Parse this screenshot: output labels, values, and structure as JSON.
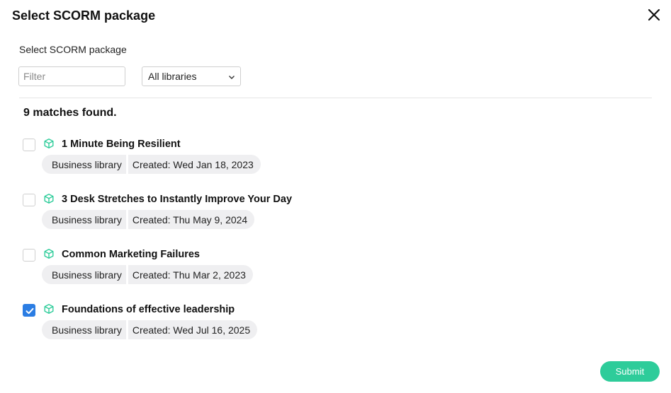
{
  "dialog": {
    "title": "Select SCORM package",
    "close_icon": "close-icon"
  },
  "form": {
    "subtitle": "Select SCORM package",
    "filter_placeholder": "Filter",
    "filter_value": "",
    "library_select": "All libraries"
  },
  "results": {
    "summary": "9 matches found.",
    "items": [
      {
        "title": "1 Minute Being Resilient",
        "library": "Business library",
        "created": "Created: Wed Jan 18, 2023",
        "checked": false
      },
      {
        "title": "3 Desk Stretches to Instantly Improve Your Day",
        "library": "Business library",
        "created": "Created: Thu May 9, 2024",
        "checked": false
      },
      {
        "title": "Common Marketing Failures",
        "library": "Business library",
        "created": "Created: Thu Mar 2, 2023",
        "checked": false
      },
      {
        "title": "Foundations of effective leadership",
        "library": "Business library",
        "created": "Created: Wed Jul 16, 2025",
        "checked": true
      }
    ]
  },
  "footer": {
    "submit_label": "Submit"
  },
  "colors": {
    "accent": "#2ecc9a",
    "checkbox_checked": "#2b7de3",
    "package_icon": "#2ecc9a"
  }
}
